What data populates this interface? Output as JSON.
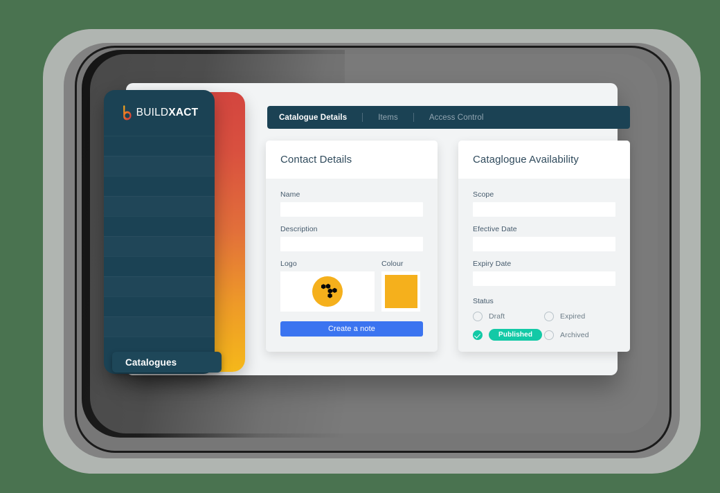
{
  "theme": {
    "page_background": "#4a7350",
    "sidebar_color": "#1b4254",
    "gradient_top": "#d3453f",
    "gradient_bottom": "#f5b81a",
    "accent_blue": "#3b74f0",
    "accent_teal": "#13c9a6",
    "swatch_yellow": "#f5b01c",
    "panel_background": "#f2f4f5"
  },
  "brand": {
    "name_light": "BUILD",
    "name_bold": "XACT",
    "mark": "buildxact-b-icon"
  },
  "sidebar": {
    "active_item": "Catalogues",
    "placeholder_rows": 11
  },
  "tabs": [
    {
      "label": "Catalogue Details",
      "active": true
    },
    {
      "label": "Items",
      "active": false
    },
    {
      "label": "Access Control",
      "active": false
    }
  ],
  "contact_card": {
    "title": "Contact Details",
    "fields": [
      {
        "label": "Name",
        "value": "",
        "placeholder": ""
      },
      {
        "label": "Description",
        "value": "",
        "placeholder": ""
      }
    ],
    "logo_label": "Logo",
    "logo_icon": "honeycomb-logo",
    "colour_label": "Colour",
    "colour_value": "#f5b01c",
    "button_label": "Create a note"
  },
  "availability_card": {
    "title": "Cataglogue Availability",
    "fields": [
      {
        "label": "Scope",
        "value": "",
        "placeholder": ""
      },
      {
        "label": "Efective Date",
        "value": "",
        "placeholder": ""
      },
      {
        "label": "Expiry Date",
        "value": "",
        "placeholder": ""
      }
    ],
    "status_label": "Status",
    "status_options": [
      {
        "label": "Draft",
        "selected": false,
        "pill": false
      },
      {
        "label": "Expired",
        "selected": false,
        "pill": false
      },
      {
        "label": "Published",
        "selected": true,
        "pill": true
      },
      {
        "label": "Archived",
        "selected": false,
        "pill": false
      }
    ]
  }
}
